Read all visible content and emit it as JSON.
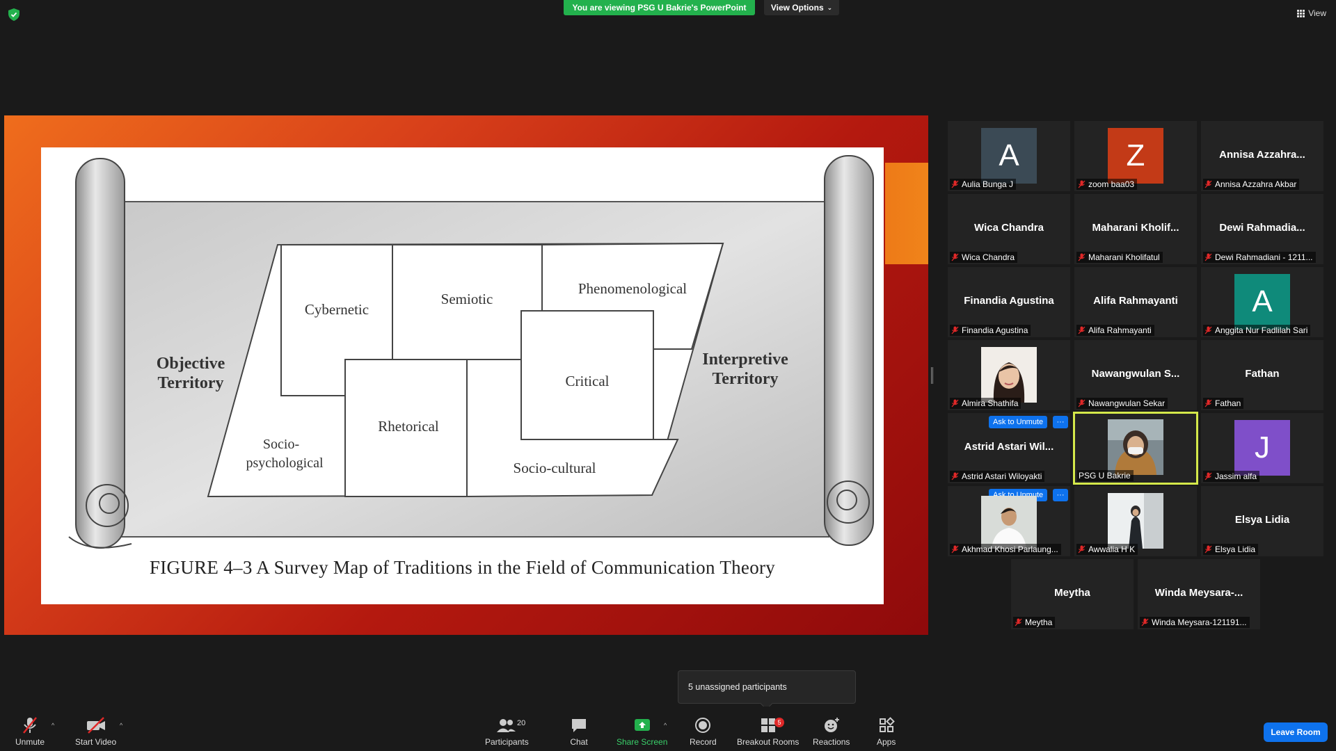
{
  "banner": {
    "viewing_text": "You are viewing PSG U Bakrie's PowerPoint",
    "view_options_label": "View Options"
  },
  "top_right": {
    "view_label": "View"
  },
  "slide": {
    "caption": "FIGURE 4–3   A Survey Map of Traditions in the Field of Communication Theory",
    "regions": {
      "objective_1": "Objective",
      "objective_2": "Territory",
      "interpretive_1": "Interpretive",
      "interpretive_2": "Territory",
      "cybernetic": "Cybernetic",
      "semiotic": "Semiotic",
      "phenomenological": "Phenomenological",
      "critical": "Critical",
      "rhetorical": "Rhetorical",
      "socio_psych_1": "Socio-",
      "socio_psych_2": "psychological",
      "socio_cultural": "Socio-cultural"
    }
  },
  "gallery": {
    "ask_to_unmute_label": "Ask to Unmute",
    "more_label": "···",
    "tiles": [
      {
        "name": "",
        "label": "Aulia Bunga J",
        "avatar_letter": "A",
        "avatar_color": "#3b4a55"
      },
      {
        "name": "",
        "label": "zoom baa03",
        "avatar_letter": "Z",
        "avatar_color": "#c33a17"
      },
      {
        "name": "Annisa  Azzahra...",
        "label": "Annisa Azzahra Akbar"
      },
      {
        "name": "Wica Chandra",
        "label": "Wica Chandra"
      },
      {
        "name": "Maharani  Kholif...",
        "label": "Maharani Kholifatul"
      },
      {
        "name": "Dewi  Rahmadia...",
        "label": "Dewi Rahmadiani - 1211..."
      },
      {
        "name": "Finandia Agustina",
        "label": "Finandia Agustina"
      },
      {
        "name": "Alifa Rahmayanti",
        "label": "Alifa Rahmayanti"
      },
      {
        "name": "",
        "label": "Anggita Nur Fadlilah Sari",
        "avatar_letter": "A",
        "avatar_color": "#0f8a7a"
      },
      {
        "name": "",
        "label": "Almira Shathifa"
      },
      {
        "name": "Nawangwulan  S...",
        "label": "Nawangwulan Sekar"
      },
      {
        "name": "Fathan",
        "label": "Fathan"
      },
      {
        "name": "Astrid Astari Wil...",
        "label": "Astrid Astari Wiloyakti"
      },
      {
        "name": "",
        "label": "PSG U Bakrie"
      },
      {
        "name": "",
        "label": "Jassim alfa",
        "avatar_letter": "J",
        "avatar_color": "#7f4fc9"
      },
      {
        "name": "",
        "label": "Akhmad Khosi Parlaung..."
      },
      {
        "name": "",
        "label": "Awwalia H K"
      },
      {
        "name": "Elsya Lidia",
        "label": "Elsya Lidia"
      },
      {
        "name": "Meytha",
        "label": "Meytha"
      },
      {
        "name": "Winda  Meysara-...",
        "label": "Winda Meysara-121191..."
      }
    ]
  },
  "tooltip": {
    "text": "5 unassigned participants"
  },
  "toolbar": {
    "unmute": "Unmute",
    "start_video": "Start Video",
    "participants": "Participants",
    "participants_count": "20",
    "chat": "Chat",
    "share_screen": "Share Screen",
    "record": "Record",
    "breakout_rooms": "Breakout Rooms",
    "breakout_badge": "5",
    "reactions": "Reactions",
    "apps": "Apps",
    "leave_room": "Leave Room"
  },
  "colors": {
    "accent_green": "#23b14d",
    "accent_blue": "#0e72ed",
    "active_speaker": "#d4e84a",
    "mute_red": "#e02828"
  }
}
